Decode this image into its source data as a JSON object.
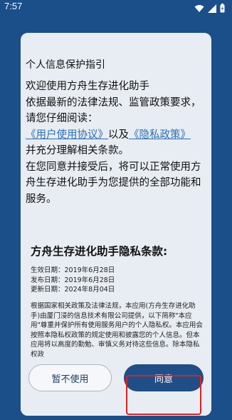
{
  "status_bar": {
    "time": "7:57",
    "icons": [
      "wifi-icon",
      "signal-icon",
      "battery-charging-icon"
    ]
  },
  "dialog": {
    "title": "个人信息保护指引",
    "intro": {
      "welcome": "欢迎使用方舟生存进化助手",
      "law": "依据最新的法律法规、监管政策要求，",
      "read": "请您仔细阅读：",
      "user_agreement": "《用户使用协议》",
      "and": "以及",
      "privacy_policy": "《隐私政策》",
      "understand": "并充分理解相关条款。",
      "consent": "在您同意并接受后，将可以正常使用方舟生存进化助手为您提供的全部功能和服务。"
    },
    "policy": {
      "title": "方舟生存进化助手隐私条款:",
      "effective": "生效日期：2019年6月28日",
      "published": "发布日期：2019年6月28日",
      "updated": "更新日期：2024年8月04日",
      "body": "根据国家相关政策及法律法规，本应用(方舟生存进化助手)由厦门浸的信息技术有限公司提供，以下简称\"本应用\"尊重并保护所有使用服务用户的个人隐私权。本应用会按照本隐私权政策的规定使用和披露您的个人信息。但本应用将以高度的勤勉、审慎义务对待这些信息。除本隐私权政"
    },
    "buttons": {
      "decline": "暂不使用",
      "agree": "同意"
    }
  },
  "colors": {
    "background": "#1b4f8a",
    "dialog": "#e8edf3",
    "link": "#2b6fb7",
    "primary_button": "#1f4f86",
    "highlight": "#e02020"
  }
}
